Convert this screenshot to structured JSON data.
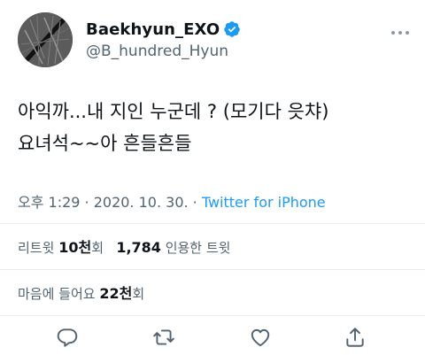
{
  "user": {
    "display_name": "Baekhyun_EXO",
    "handle": "@B_hundred_Hyun"
  },
  "tweet": {
    "line1": "아익까...내 지인 누군데 ? (모기다 읏챠)",
    "line2": "요녀석~~아 흔들흔들"
  },
  "meta": {
    "timestamp": "오후 1:29 · 2020. 10. 30. · ",
    "source": "Twitter for iPhone"
  },
  "stats": {
    "retweets_label": "리트윗",
    "retweets_count": "10천",
    "retweets_suffix": "회",
    "quotes_count": "1,784",
    "quotes_label": "인용한 트윗",
    "likes_label": "마음에 들어요",
    "likes_count": "22천",
    "likes_suffix": "회"
  },
  "colors": {
    "accent": "#1d9bf0",
    "secondary_text": "#536471",
    "icon": "#536471"
  },
  "icons": [
    "verified-badge-icon",
    "more-options-icon",
    "reply-icon",
    "retweet-icon",
    "like-icon",
    "share-icon"
  ]
}
